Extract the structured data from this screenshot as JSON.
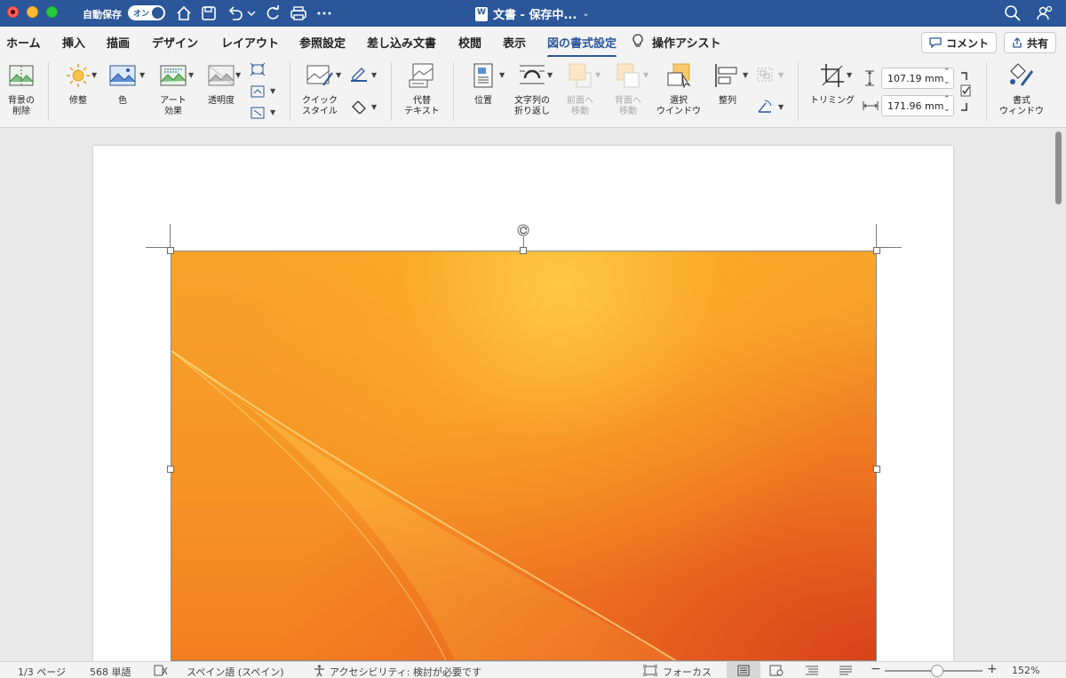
{
  "titlebar": {
    "autosave_label": "自動保存",
    "autosave_state": "オン",
    "doc_title": "文書 - 保存中...",
    "title_chevron": "⌄"
  },
  "tabs": [
    "ホーム",
    "挿入",
    "描画",
    "デザイン",
    "レイアウト",
    "参照設定",
    "差し込み文書",
    "校閲",
    "表示",
    "図の書式設定",
    "操作アシスト"
  ],
  "active_tab": "図の書式設定",
  "header_buttons": {
    "comment": "コメント",
    "share": "共有"
  },
  "ribbon": {
    "remove_bg_1": "背景の",
    "remove_bg_2": "削除",
    "corrections": "修整",
    "color": "色",
    "artistic_1": "アート",
    "artistic_2": "効果",
    "transparency": "透明度",
    "quick_styles_1": "クイック",
    "quick_styles_2": "スタイル",
    "alt_text_1": "代替",
    "alt_text_2": "テキスト",
    "position": "位置",
    "wrap_1": "文字列の",
    "wrap_2": "折り返し",
    "forward_1": "前面へ",
    "forward_2": "移動",
    "backward_1": "背面へ",
    "backward_2": "移動",
    "selection_1": "選択",
    "selection_2": "ウインドウ",
    "align": "整列",
    "crop": "トリミング",
    "height_value": "107.19 mm",
    "width_value": "171.96 mm",
    "format_pane_1": "書式",
    "format_pane_2": "ウィンドウ"
  },
  "statusbar": {
    "page": "1/3 ページ",
    "words": "568 単語",
    "language": "スペイン語 (スペイン)",
    "accessibility": "アクセシビリティ: 検討が必要です",
    "focus": "フォーカス",
    "zoom": "152%"
  },
  "colors": {
    "accent": "#2b579a",
    "image_orange": "#f69226"
  }
}
